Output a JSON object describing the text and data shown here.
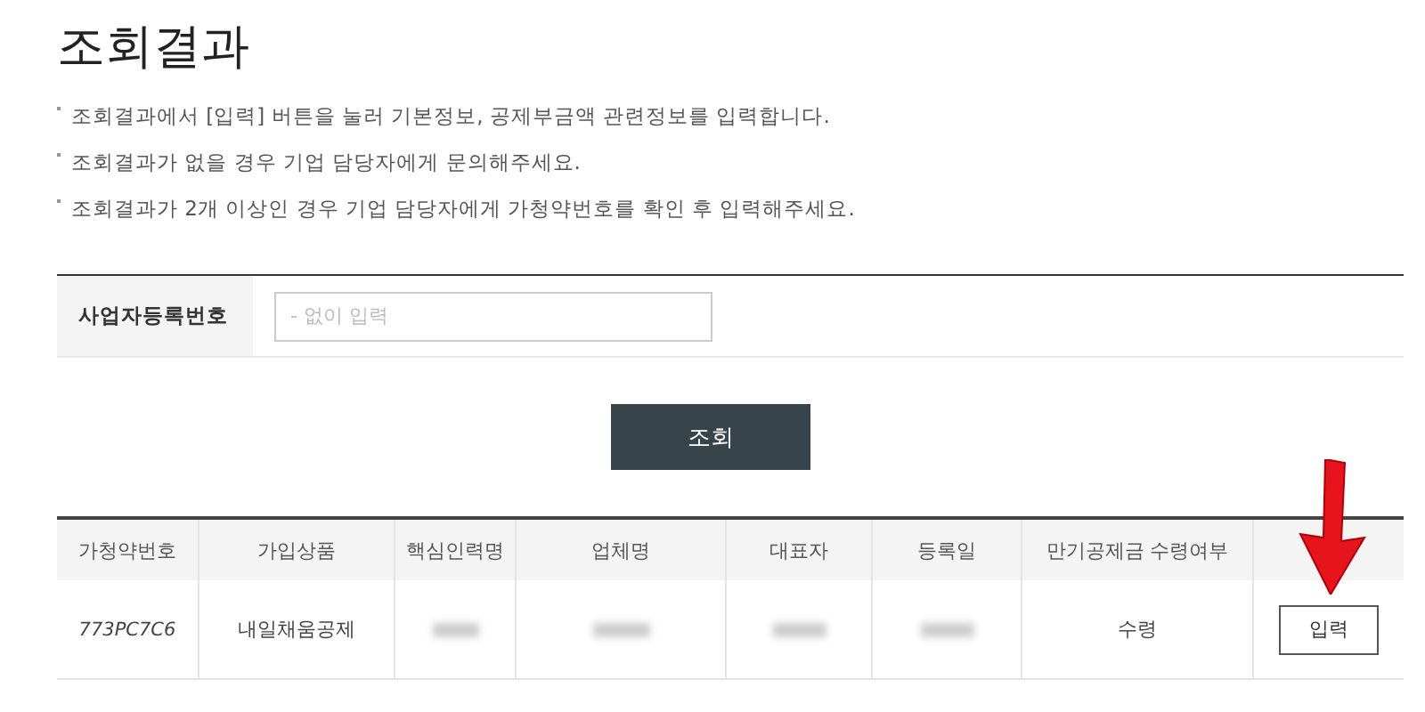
{
  "title": "조회결과",
  "notes": [
    "조회결과에서 [입력] 버튼을 눌러 기본정보, 공제부금액 관련정보를 입력합니다.",
    "조회결과가 없을 경우 기업 담당자에게 문의해주세요.",
    "조회결과가 2개 이상인 경우 기업 담당자에게 가청약번호를 확인 후 입력해주세요."
  ],
  "search": {
    "label": "사업자등록번호",
    "placeholder": "- 없이 입력",
    "button": "조회"
  },
  "table": {
    "columns": [
      "가청약번호",
      "가입상품",
      "핵심인력명",
      "업체명",
      "대표자",
      "등록일",
      "만기공제금 수령여부"
    ],
    "rows": [
      {
        "cells": [
          {
            "kind": "text",
            "text": "773PC7C6"
          },
          {
            "kind": "text",
            "text": "내일채움공제"
          },
          {
            "kind": "blurred"
          },
          {
            "kind": "blurred"
          },
          {
            "kind": "blurred"
          },
          {
            "kind": "blurred"
          },
          {
            "kind": "text",
            "text": "수령"
          }
        ],
        "action": "입력"
      }
    ]
  }
}
